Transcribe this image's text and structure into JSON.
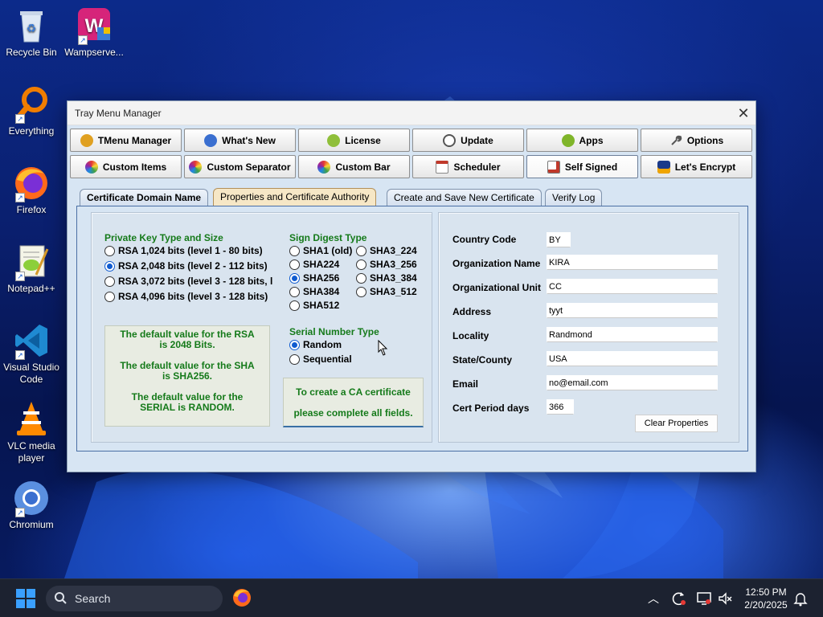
{
  "desktop": {
    "icons": [
      {
        "label": "Recycle Bin",
        "icon": "recycle-bin-icon"
      },
      {
        "label": "Wampserve...",
        "icon": "wampserver-icon"
      },
      {
        "label": "Everything",
        "icon": "everything-search-icon"
      },
      {
        "label": "Firefox",
        "icon": "firefox-icon"
      },
      {
        "label": "Notepad++",
        "icon": "notepadpp-icon"
      },
      {
        "label": "Visual Studio Code",
        "icon": "vscode-icon"
      },
      {
        "label": "VLC media player",
        "icon": "vlc-icon"
      },
      {
        "label": "Chromium",
        "icon": "chromium-icon"
      }
    ]
  },
  "window": {
    "title": "Tray Menu Manager",
    "close_glyph": "✕",
    "main_tabs_row1": [
      {
        "label": "TMenu Manager",
        "icon": "tmenu-icon",
        "color": "#e0a020"
      },
      {
        "label": "What's New",
        "icon": "globe-icon",
        "color": "#3a6fd0"
      },
      {
        "label": "License",
        "icon": "license-icon",
        "color": "#8fbf3a"
      },
      {
        "label": "Update",
        "icon": "clock-icon",
        "color": "#555555"
      },
      {
        "label": "Apps",
        "icon": "apps-icon",
        "color": "#7fb52a"
      },
      {
        "label": "Options",
        "icon": "wrench-icon",
        "color": "#666666"
      }
    ],
    "main_tabs_row2": [
      {
        "label": "Custom Items",
        "icon": "color-wheel-icon",
        "color": "#d04a8a"
      },
      {
        "label": "Custom Separator",
        "icon": "color-wheel-icon",
        "color": "#d04a8a"
      },
      {
        "label": "Custom Bar",
        "icon": "color-wheel-icon",
        "color": "#d04a8a"
      },
      {
        "label": "Scheduler",
        "icon": "calendar-icon",
        "color": "#c0392b"
      },
      {
        "label": "Self Signed",
        "icon": "certificate-icon",
        "color": "#c0392b",
        "active": true
      },
      {
        "label": "Let's Encrypt",
        "icon": "lets-encrypt-icon",
        "color": "#e0a020"
      }
    ],
    "sub_tabs": [
      {
        "label": "Certificate Domain Name"
      },
      {
        "label": "Properties and Certificate Authority",
        "active": true
      },
      {
        "label": "Create and Save New Certificate"
      },
      {
        "label": "Verify Log"
      }
    ],
    "key": {
      "title": "Private Key Type and Size",
      "options": [
        {
          "label": "RSA 1,024 bits (level 1 - 80 bits)",
          "checked": false
        },
        {
          "label": "RSA 2,048 bits (level 2 - 112 bits)",
          "checked": true
        },
        {
          "label": "RSA 3,072 bits (level 3 - 128 bits, l",
          "checked": false
        },
        {
          "label": "RSA 4,096 bits (level 3 - 128 bits)",
          "checked": false
        }
      ],
      "notes": [
        "The default value for the RSA is 2048 Bits.",
        "The default value for the SHA is SHA256.",
        "The default value for the SERIAL is RANDOM."
      ]
    },
    "digest": {
      "title": "Sign Digest Type",
      "col1": [
        {
          "label": "SHA1 (old)",
          "checked": false
        },
        {
          "label": "SHA224",
          "checked": false
        },
        {
          "label": "SHA256",
          "checked": true
        },
        {
          "label": "SHA384",
          "checked": false
        },
        {
          "label": "SHA512",
          "checked": false
        }
      ],
      "col2": [
        {
          "label": "SHA3_224",
          "checked": false
        },
        {
          "label": "SHA3_256",
          "checked": false
        },
        {
          "label": "SHA3_384",
          "checked": false
        },
        {
          "label": "SHA3_512",
          "checked": false
        }
      ]
    },
    "serial": {
      "title": "Serial Number Type",
      "options": [
        {
          "label": "Random",
          "checked": true
        },
        {
          "label": "Sequential",
          "checked": false
        }
      ],
      "ca_note": [
        "To create a CA certificate",
        "please complete all fields."
      ]
    },
    "properties": [
      {
        "label": "Country Code",
        "value": "BY"
      },
      {
        "label": "Organization Name",
        "value": "KIRA"
      },
      {
        "label": "Organizational Unit",
        "value": "CC"
      },
      {
        "label": "Address",
        "value": "tyyt"
      },
      {
        "label": "Locality",
        "value": "Randmond"
      },
      {
        "label": "State/County",
        "value": "USA"
      },
      {
        "label": "Email",
        "value": "no@email.com"
      },
      {
        "label": "Cert Period days",
        "value": "366"
      }
    ],
    "clear_button": "Clear Properties"
  },
  "taskbar": {
    "search_placeholder": "Search",
    "time": "12:50 PM",
    "date": "2/20/2025",
    "tray_icons": [
      "chevron-up-icon",
      "sync-icon",
      "display-icon",
      "volume-mute-icon",
      "notification-bell-icon"
    ]
  }
}
